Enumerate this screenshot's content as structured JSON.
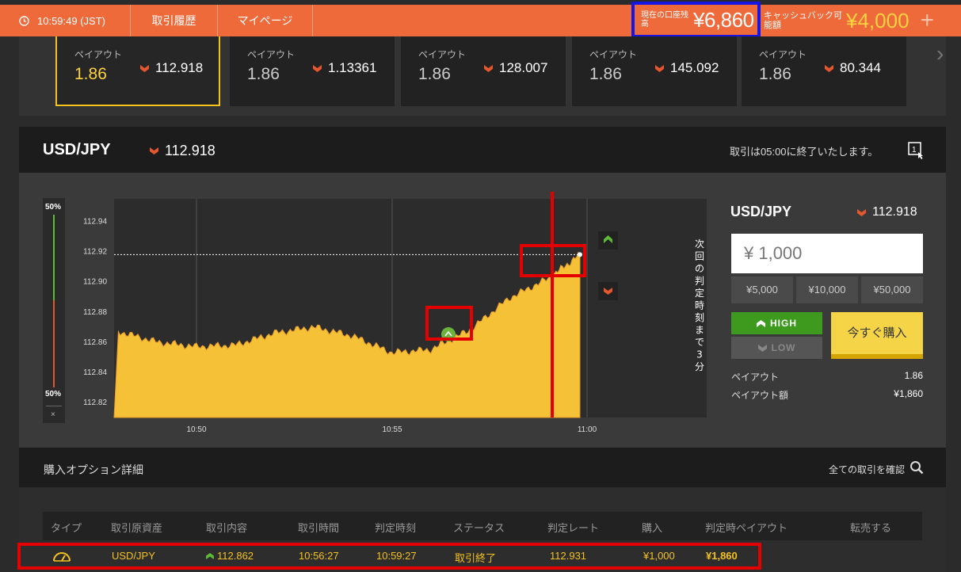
{
  "header": {
    "time": "10:59:49 (JST)",
    "nav_history": "取引履歴",
    "nav_mypage": "マイページ",
    "balance_label": "現在の口座残高",
    "balance_value": "¥6,860",
    "cashback_label": "キャッシュバック可能額",
    "cashback_value": "¥4,000",
    "add_symbol": "+"
  },
  "assets": [
    {
      "payout_label": "ペイアウト",
      "payout": "1.86",
      "rate": "112.918",
      "active": true
    },
    {
      "payout_label": "ペイアウト",
      "payout": "1.86",
      "rate": "1.13361",
      "active": false
    },
    {
      "payout_label": "ペイアウト",
      "payout": "1.86",
      "rate": "128.007",
      "active": false
    },
    {
      "payout_label": "ペイアウト",
      "payout": "1.86",
      "rate": "145.092",
      "active": false
    },
    {
      "payout_label": "ペイアウト",
      "payout": "1.86",
      "rate": "80.344",
      "active": false
    }
  ],
  "title": {
    "pair": "USD/JPY",
    "rate": "112.918",
    "info": "取引は05:00に終了いたします。"
  },
  "gauge": {
    "top": "50%",
    "bottom": "50%",
    "close": "×"
  },
  "chart_data": {
    "type": "area",
    "y_ticks": [
      "112.94",
      "112.92",
      "112.90",
      "112.88",
      "112.86",
      "112.84",
      "112.82"
    ],
    "x_ticks": [
      "10:50",
      "10:55",
      "11:00"
    ],
    "ylim": [
      112.81,
      112.955
    ],
    "current_rate": 112.918,
    "entry_rate": 112.862,
    "countdown_label": "次回の判定時刻まで3分",
    "x": [
      "10:48",
      "10:49",
      "10:50",
      "10:51",
      "10:52",
      "10:53",
      "10:54",
      "10:55",
      "10:56",
      "10:57",
      "10:58",
      "10:59",
      "10:59:49"
    ],
    "values": [
      112.867,
      112.86,
      112.857,
      112.858,
      112.866,
      112.87,
      112.864,
      112.853,
      112.855,
      112.868,
      112.889,
      112.902,
      112.918
    ]
  },
  "trade": {
    "pair": "USD/JPY",
    "rate": "112.918",
    "amount": "¥ 1,000",
    "presets": [
      "¥5,000",
      "¥10,000",
      "¥50,000"
    ],
    "high_label": "HIGH",
    "low_label": "LOW",
    "buy_label": "今すぐ購入",
    "payout_label": "ペイアウト",
    "payout_value": "1.86",
    "payout_amount_label": "ペイアウト額",
    "payout_amount_value": "¥1,860"
  },
  "options": {
    "title": "購入オプション詳細",
    "view_all": "全ての取引を確認",
    "columns": [
      "タイプ",
      "取引原資産",
      "取引内容",
      "取引時間",
      "判定時刻",
      "ステータス",
      "判定レート",
      "購入",
      "判定時ペイアウト",
      "転売する"
    ],
    "row": {
      "asset": "USD/JPY",
      "content": "112.862",
      "time": "10:56:27",
      "judge_time": "10:59:27",
      "status": "取引終了",
      "judge_rate": "112.931",
      "purchase": "¥1,000",
      "payout": "¥1,860"
    }
  },
  "colors": {
    "brand": "#ee6a3b",
    "accent": "#f4c21d",
    "high": "#3d9a1e",
    "down": "#e5572e",
    "annotation_red": "#e50000",
    "annotation_blue": "#1515e6"
  }
}
